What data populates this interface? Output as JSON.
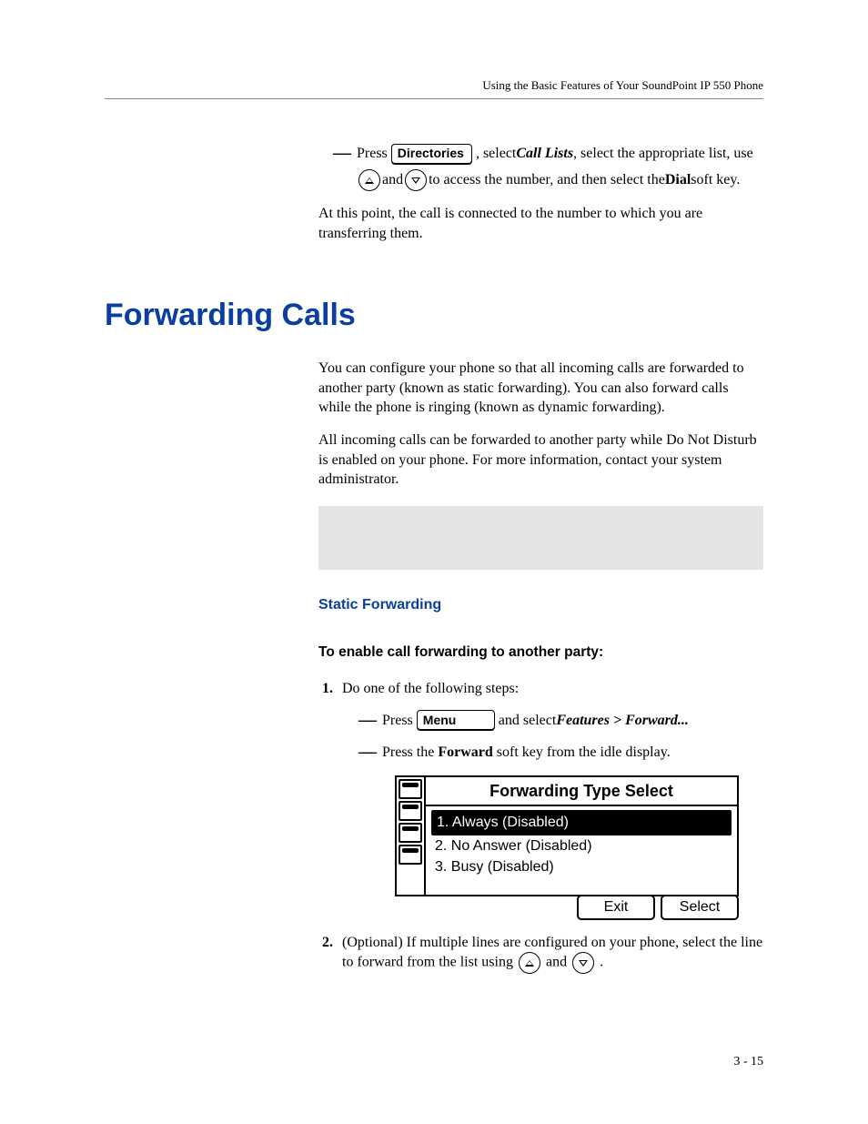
{
  "header": {
    "running": "Using the Basic Features of Your SoundPoint IP 550 Phone"
  },
  "intro": {
    "press": "Press",
    "directories_btn": "Directories",
    "seg1": ", select ",
    "call_lists": "Call Lists",
    "seg2": ", select the appropriate list, use",
    "and": " and ",
    "seg3": " to access the number, and then select the ",
    "dial": "Dial",
    "seg4": " soft key.",
    "after": "At this point, the call is connected to the number to which you are transferring them."
  },
  "section": {
    "title": "Forwarding Calls",
    "p1": "You can configure your phone so that all incoming calls are forwarded to another party (known as static forwarding). You can also forward calls while the phone is ringing (known as dynamic forwarding).",
    "p2": "All incoming calls can be forwarded to another party while Do Not Disturb is enabled on your phone. For more information, contact your system administrator."
  },
  "static": {
    "heading": "Static Forwarding",
    "proc_title": "To enable call forwarding to another party:",
    "step1": "Do one of the following steps:",
    "press": "Press",
    "menu_btn": "Menu",
    "and_select": " and select ",
    "path": "Features > Forward...",
    "alt_a": "Press the ",
    "forward": "Forward",
    "alt_b": " soft key from the idle display.",
    "step2a": "(Optional) If multiple lines are configured on your phone, select the line to forward from the list using ",
    "step2_and": " and ",
    "step2_end": "."
  },
  "lcd": {
    "title": "Forwarding Type Select",
    "items": [
      "1. Always (Disabled)",
      "2. No Answer (Disabled)",
      "3. Busy (Disabled)"
    ],
    "soft_exit": "Exit",
    "soft_select": "Select"
  },
  "footer": {
    "page": "3 - 15"
  }
}
